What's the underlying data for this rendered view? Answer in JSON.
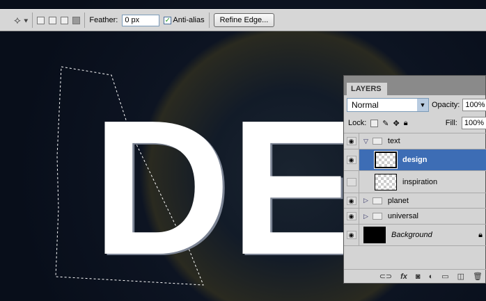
{
  "toolbar": {
    "feather_label": "Feather:",
    "feather_value": "0 px",
    "anti_alias_label": "Anti-alias",
    "anti_alias_checked": true,
    "refine_edge_label": "Refine Edge..."
  },
  "artwork": {
    "letter1": "D",
    "letter2": "E"
  },
  "layers_panel": {
    "tab": "LAYERS",
    "blend_mode": "Normal",
    "opacity_label": "Opacity:",
    "opacity_value": "100%",
    "lock_label": "Lock:",
    "fill_label": "Fill:",
    "fill_value": "100%",
    "layers": [
      {
        "name": "text",
        "type": "group",
        "expanded": true,
        "visible": true
      },
      {
        "name": "design",
        "type": "layer",
        "selected": true,
        "visible": true
      },
      {
        "name": "inspiration",
        "type": "layer",
        "visible": false
      },
      {
        "name": "planet",
        "type": "group",
        "expanded": false,
        "visible": true
      },
      {
        "name": "universal",
        "type": "group",
        "expanded": false,
        "visible": true
      },
      {
        "name": "Background",
        "type": "background",
        "locked": true,
        "visible": true
      }
    ]
  },
  "colors": {
    "selection": "#3d6db5",
    "canvas": "#0a1120"
  }
}
